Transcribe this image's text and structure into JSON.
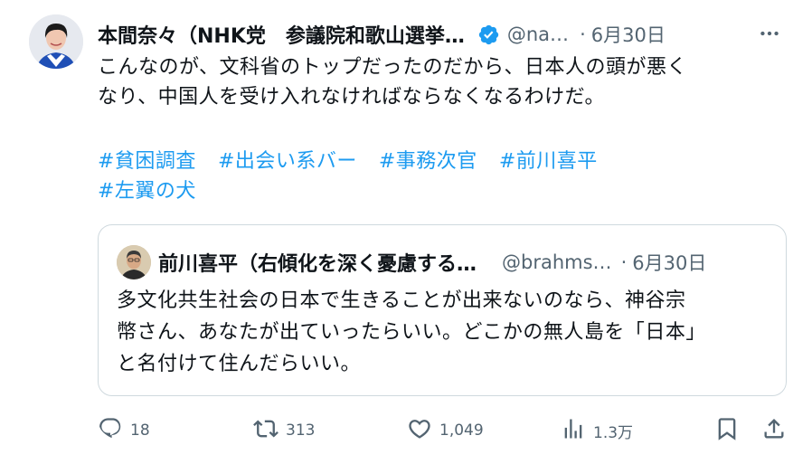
{
  "author": {
    "name": "本間奈々（NHK党　参議院和歌山選挙…",
    "handle": "@na…",
    "date": "6月30日",
    "separator": "·"
  },
  "tweet": {
    "lines": [
      "こんなのが、文科省のトップだったのだから、日本人の頭が悪く",
      "なり、中国人を受け入れなければならなくなるわけだ。"
    ],
    "hashtags_row1": [
      "#貧困調査",
      "#出会い系バー",
      "#事務次官",
      "#前川喜平"
    ],
    "hashtags_row2": [
      "#左翼の犬"
    ]
  },
  "quote": {
    "name": "前川喜平（右傾化を深く憂慮する…",
    "handle": "@brahms…",
    "date": "6月30日",
    "separator": "·",
    "lines": [
      "多文化共生社会の日本で生きることが出来ないのなら、神谷宗",
      "幣さん、あなたが出ていったらいい。どこかの無人島を「日本」",
      "と名付けて住んだらいい。"
    ]
  },
  "actions": {
    "replies": "18",
    "reposts": "313",
    "likes": "1,049",
    "views": "1.3万"
  },
  "icons": {
    "verified": "verified-badge-icon",
    "more": "more-icon",
    "reply": "reply-icon",
    "repost": "repost-icon",
    "like": "like-icon",
    "views": "views-icon",
    "bookmark": "bookmark-icon",
    "share": "share-icon"
  },
  "colors": {
    "link": "#1d9bf0",
    "muted": "#536471",
    "text": "#0f1419",
    "border": "#cfd9de"
  }
}
